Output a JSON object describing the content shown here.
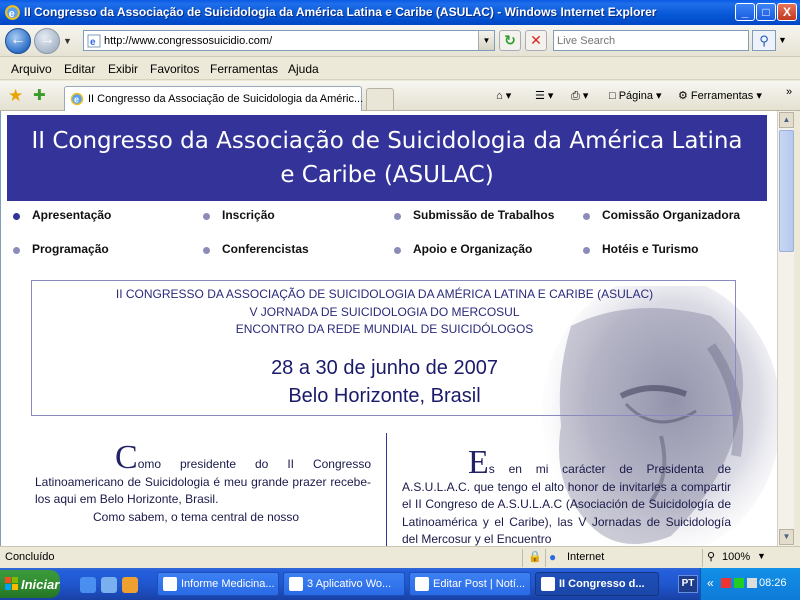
{
  "window": {
    "title": "II Congresso da Associação de Suicidologia da América Latina e Caribe (ASULAC) - Windows Internet Explorer",
    "minimize": "_",
    "maximize": "□",
    "close": "X"
  },
  "address": {
    "url": "http://www.congressosuicidio.com/"
  },
  "search": {
    "placeholder": "Live Search"
  },
  "menu": [
    "Arquivo",
    "Editar",
    "Exibir",
    "Favoritos",
    "Ferramentas",
    "Ajuda"
  ],
  "tab": {
    "label": "II Congresso da Associação de Suicidologia da Améric..."
  },
  "commands": {
    "page": "Página",
    "tools": "Ferramentas"
  },
  "page": {
    "banner": [
      "II Congresso da Associação de Suicidologia da América Latina",
      "e Caribe (ASULAC)"
    ],
    "nav": [
      {
        "label": "Apresentação",
        "active": true
      },
      {
        "label": "Inscrição"
      },
      {
        "label": "Submissão de Trabalhos"
      },
      {
        "label": "Comissão Organizadora"
      },
      {
        "label": "Programação"
      },
      {
        "label": "Conferencistas"
      },
      {
        "label": "Apoio e Organização"
      },
      {
        "label": "Hotéis e Turismo"
      }
    ],
    "info": {
      "line1": "II CONGRESSO DA ASSOCIAÇÃO DE SUICIDOLOGIA DA AMÉRICA LATINA E CARIBE (ASULAC)",
      "line2": "V JORNADA DE SUICIDOLOGIA DO MERCOSUL",
      "line3": "ENCONTRO DA REDE MUNDIAL DE SUICIDÓLOGOS",
      "date": "28 a 30 de junho de 2007",
      "place": "Belo Horizonte, Brasil"
    },
    "left": {
      "cap": "C",
      "text": "omo presidente do II Congresso Latinoamericano de Suicidologia é meu grande prazer recebe-los aqui em Belo Horizonte, Brasil.",
      "text2": "Como sabem, o tema central de nosso"
    },
    "right": {
      "cap": "E",
      "text": "s en mi carácter de Presidenta de A.S.U.L.A.C. que tengo el alto honor de invitarles a compartir el II Congreso de A.S.U.L.A.C (Asociación de Suicidología de Latinoamérica y el Caribe), las V Jornadas de Suicidología del Mercosur y el Encuentro"
    }
  },
  "status": {
    "text": "Concluído",
    "zone": "Internet",
    "zoom": "100%"
  },
  "taskbar": {
    "start": "Iniciar",
    "tasks": [
      {
        "label": "Informe Medicina..."
      },
      {
        "label": "3 Aplicativo Wo..."
      },
      {
        "label": "Editar Post | Notí..."
      },
      {
        "label": "II Congresso d...",
        "active": true
      }
    ],
    "lang": "PT",
    "clock": "08:26"
  }
}
